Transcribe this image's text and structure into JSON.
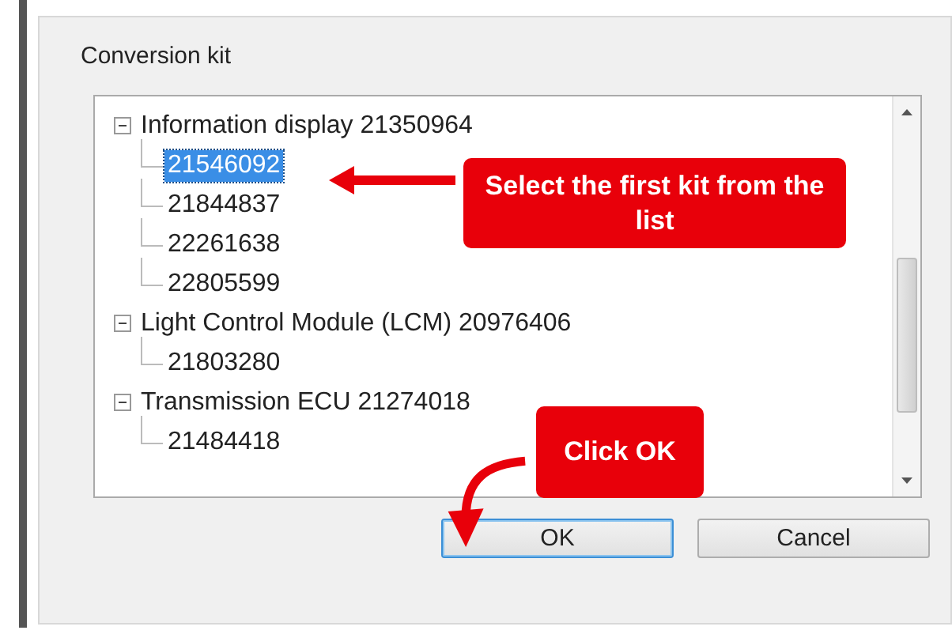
{
  "group": {
    "label": "Conversion kit"
  },
  "tree": [
    {
      "label": "Information display 21350964",
      "expanded": true,
      "children": [
        {
          "label": "21546092",
          "selected": true
        },
        {
          "label": "21844837",
          "selected": false
        },
        {
          "label": "22261638",
          "selected": false
        },
        {
          "label": "22805599",
          "selected": false
        }
      ]
    },
    {
      "label": "Light Control Module (LCM) 20976406",
      "expanded": true,
      "children": [
        {
          "label": "21803280",
          "selected": false
        }
      ]
    },
    {
      "label": "Transmission ECU 21274018",
      "expanded": true,
      "children": [
        {
          "label": "21484418",
          "selected": false
        }
      ]
    }
  ],
  "buttons": [
    {
      "label": "OK",
      "kind": "default"
    },
    {
      "label": "Cancel",
      "kind": "normal"
    }
  ],
  "annotations": [
    {
      "kind": "callout-left",
      "text": "Select the first kit from the list"
    },
    {
      "kind": "callout-down",
      "text": "Click OK"
    }
  ]
}
